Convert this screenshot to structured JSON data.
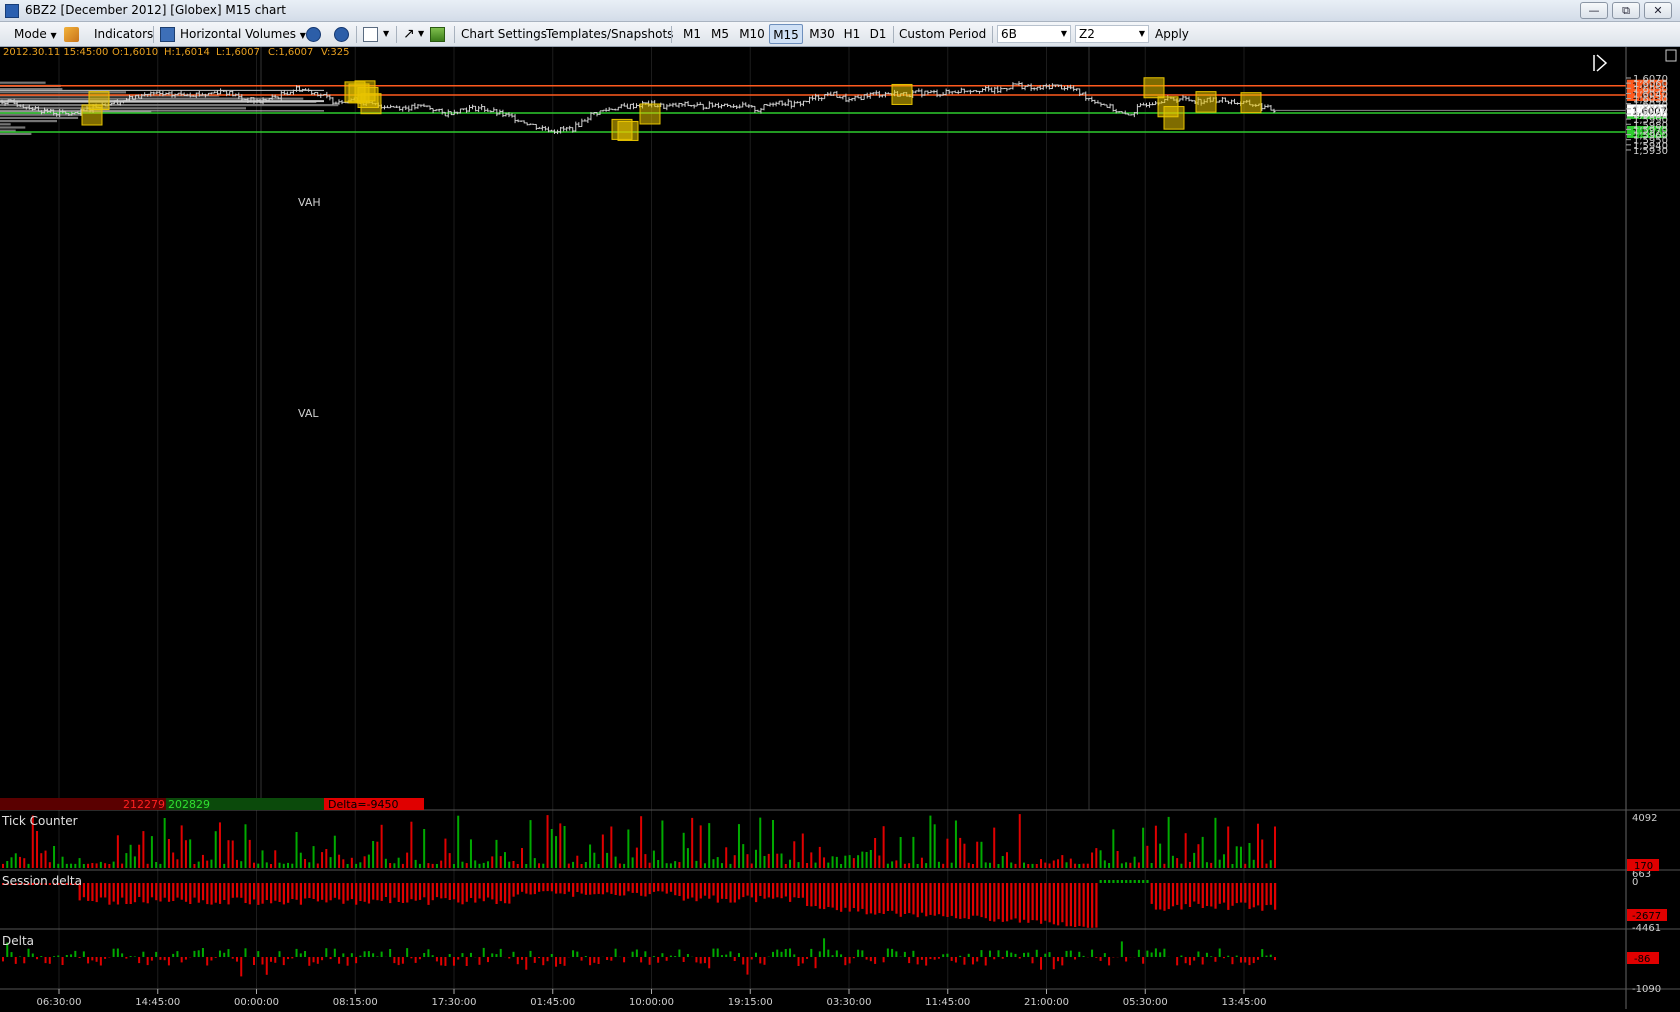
{
  "window": {
    "title": "6BZ2 [December 2012] [Globex] M15 chart",
    "buttons": [
      "minimize",
      "restore",
      "close"
    ]
  },
  "toolbar": {
    "mode": "Mode",
    "indicators": "Indicators",
    "horizontal_volumes": "Horizontal Volumes",
    "chart_settings": "Chart Settings",
    "templates": "Templates/Snapshots",
    "timeframes": [
      "M1",
      "M5",
      "M10",
      "M15",
      "M30",
      "H1",
      "D1"
    ],
    "active_timeframe": "M15",
    "custom_period": "Custom Period",
    "symbol": "6B",
    "contract": "Z2",
    "apply": "Apply"
  },
  "ohlc_readout": {
    "datetime": "2012.30.11 15:45:00",
    "open": "O:1,6010",
    "high": "H:1,6014",
    "low": "L:1,6007",
    "close": "C:1,6007",
    "volume": "V:325"
  },
  "colors": {
    "resistance": "#ff5a1e",
    "support": "#2ecc2e",
    "highlight_box": "#e8c400",
    "profile": "#8a8a8a",
    "candles": "#d0d0d0",
    "neg_bar": "#e00000",
    "pos_bar": "#00aa00"
  },
  "chart_data": {
    "type": "line",
    "instrument": "6BZ2",
    "timeframe": "M15",
    "price_axis": {
      "ticks": [
        "1,6070",
        "1,6060",
        "1,6050",
        "1,6040",
        "1,6030",
        "1,6020",
        "1,6010",
        "1,6000",
        "1,5990",
        "1,5980",
        "1,5970",
        "1,5960",
        "1,5950",
        "1,5940",
        "1,5930"
      ],
      "range": [
        1.5927,
        1.6075
      ]
    },
    "time_axis": {
      "ticks": [
        "06:30:00",
        "14:45:00",
        "00:00:00",
        "08:15:00",
        "17:30:00",
        "01:45:00",
        "10:00:00",
        "19:15:00",
        "03:30:00",
        "11:45:00",
        "21:00:00",
        "05:30:00",
        "13:45:00"
      ]
    },
    "levels": [
      {
        "label": "1,6055",
        "value": 1.6055,
        "kind": "resistance"
      },
      {
        "label": "1,6037",
        "value": 1.6037,
        "kind": "resistance"
      },
      {
        "label": "1,6002",
        "value": 1.6002,
        "kind": "support"
      },
      {
        "label": "1,5965",
        "value": 1.5965,
        "kind": "support"
      }
    ],
    "last_price": {
      "label": "1,6007",
      "value": 1.6007
    },
    "volume_profile": {
      "vah_label": "VAH",
      "val_label": "VAL",
      "vah": 1.6046,
      "val": 1.6006
    },
    "price_series_approx": [
      [
        0,
        1.6025
      ],
      [
        1,
        1.6018
      ],
      [
        2,
        1.6008
      ],
      [
        3,
        1.6002
      ],
      [
        4,
        1.5998
      ],
      [
        5,
        1.6015
      ],
      [
        6,
        1.6022
      ],
      [
        7,
        1.603
      ],
      [
        8,
        1.604
      ],
      [
        9,
        1.6036
      ],
      [
        10,
        1.604
      ],
      [
        11,
        1.6038
      ],
      [
        12,
        1.6046
      ],
      [
        13,
        1.603
      ],
      [
        14,
        1.6024
      ],
      [
        15,
        1.6035
      ],
      [
        16,
        1.605
      ],
      [
        17,
        1.6042
      ],
      [
        18,
        1.6025
      ],
      [
        19,
        1.6028
      ],
      [
        20,
        1.6018
      ],
      [
        21,
        1.6015
      ],
      [
        22,
        1.6012
      ],
      [
        23,
        1.6015
      ],
      [
        24,
        1.6
      ],
      [
        25,
        1.601
      ],
      [
        26,
        1.6012
      ],
      [
        27,
        1.6
      ],
      [
        28,
        1.599
      ],
      [
        29,
        1.5975
      ],
      [
        30,
        1.5968
      ],
      [
        31,
        1.5972
      ],
      [
        32,
        1.6
      ],
      [
        33,
        1.601
      ],
      [
        34,
        1.6015
      ],
      [
        35,
        1.602
      ],
      [
        36,
        1.6014
      ],
      [
        37,
        1.6018
      ],
      [
        38,
        1.6015
      ],
      [
        39,
        1.6019
      ],
      [
        40,
        1.6016
      ],
      [
        41,
        1.6008
      ],
      [
        42,
        1.6025
      ],
      [
        43,
        1.6018
      ],
      [
        44,
        1.603
      ],
      [
        45,
        1.604
      ],
      [
        46,
        1.6025
      ],
      [
        47,
        1.6038
      ],
      [
        48,
        1.604
      ],
      [
        49,
        1.6038
      ],
      [
        50,
        1.6042
      ],
      [
        51,
        1.604
      ],
      [
        52,
        1.6046
      ],
      [
        53,
        1.6048
      ],
      [
        54,
        1.6045
      ],
      [
        55,
        1.6058
      ],
      [
        56,
        1.6048
      ],
      [
        57,
        1.6055
      ],
      [
        58,
        1.605
      ],
      [
        59,
        1.603
      ],
      [
        60,
        1.6015
      ],
      [
        61,
        1.5995
      ],
      [
        62,
        1.602
      ],
      [
        63,
        1.6028
      ],
      [
        64,
        1.603
      ],
      [
        65,
        1.6025
      ],
      [
        66,
        1.6028
      ],
      [
        67,
        1.6022
      ],
      [
        68,
        1.6018
      ],
      [
        69,
        1.6007
      ]
    ],
    "panels": [
      {
        "name": "Tick Counter",
        "axis_top": "4092",
        "value": "170"
      },
      {
        "name": "Session delta",
        "axis_top": "663",
        "axis_zero": "0",
        "axis_bottom": "-4461",
        "value": "-2677"
      },
      {
        "name": "Delta",
        "axis_bottom": "-1090",
        "value": "-86"
      }
    ],
    "buy_sell_bar": {
      "sell": "212279",
      "buy": "202829",
      "delta": "Delta=-9450"
    }
  }
}
